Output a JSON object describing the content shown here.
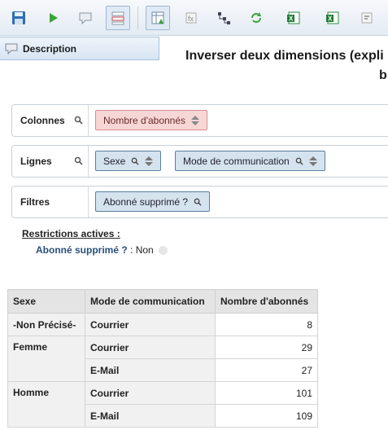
{
  "toolbar": {
    "buttons": [
      {
        "icon": "save-icon"
      },
      {
        "icon": "run-icon"
      },
      {
        "icon": "comment-icon"
      },
      {
        "icon": "layout-icon",
        "active": true
      },
      {
        "icon": "table-export-icon",
        "active": true
      },
      {
        "icon": "formula-icon"
      },
      {
        "icon": "hierarchy-icon"
      },
      {
        "icon": "refresh-icon"
      },
      {
        "icon": "excel-icon"
      },
      {
        "icon": "excel-export-icon"
      },
      {
        "icon": "text-comment-icon"
      }
    ]
  },
  "description_tab": {
    "label": "Description"
  },
  "page_title": {
    "line1": "Inverser deux dimensions (expli",
    "line2": "b"
  },
  "colonnes": {
    "label": "Colonnes",
    "chips": [
      "Nombre d'abonnés"
    ]
  },
  "lignes": {
    "label": "Lignes",
    "chips": [
      "Sexe",
      "Mode de communication"
    ]
  },
  "filtres": {
    "label": "Filtres",
    "chips": [
      "Abonné supprimé ?"
    ]
  },
  "restrictions": {
    "title": "Restrictions actives :",
    "key": "Abonné supprimé ?",
    "sep": " : ",
    "value": "Non"
  },
  "table": {
    "headers": [
      "Sexe",
      "Mode de communication",
      "Nombre d'abonnés"
    ],
    "rows": [
      {
        "sexe": "-Non Précisé-",
        "mode": "Courrier",
        "count": "8"
      },
      {
        "sexe": "Femme",
        "mode": "Courrier",
        "count": "29"
      },
      {
        "sexe": "",
        "mode": "E-Mail",
        "count": "27"
      },
      {
        "sexe": "Homme",
        "mode": "Courrier",
        "count": "101"
      },
      {
        "sexe": "",
        "mode": "E-Mail",
        "count": "109"
      }
    ]
  }
}
